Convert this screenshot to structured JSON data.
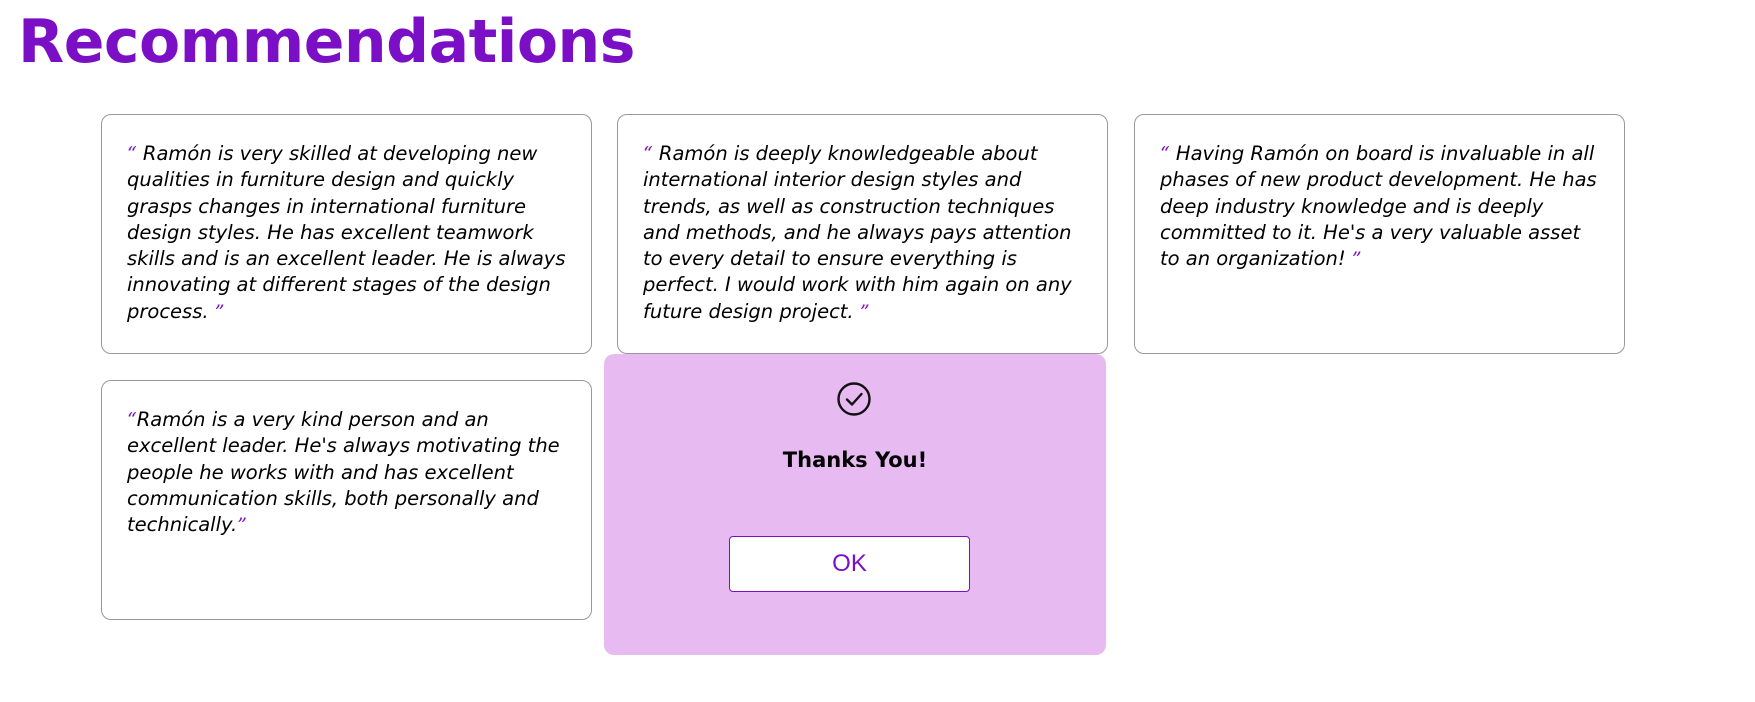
{
  "page": {
    "title": "Recommendations"
  },
  "colors": {
    "accent": "#7a0fc6",
    "modal_background": "#e7bbf2",
    "card_border": "#999999"
  },
  "recommendations": [
    {
      "open_quote": "“",
      "text": "Ramón is very skilled at developing new qualities in furniture design and quickly grasps changes in international furniture design styles. He has excellent teamwork skills and is an excellent leader. He is always innovating at different stages of the design process.",
      "close_quote": "”"
    },
    {
      "open_quote": "“",
      "text": "Ramón is deeply knowledgeable about international interior design styles and trends, as well as construction techniques and methods, and he always pays attention to every detail to ensure everything is perfect. I would work with him again on any future design project.",
      "close_quote": "”"
    },
    {
      "open_quote": "“",
      "text": "Having Ramón on board is invaluable in all phases of new product development. He has deep industry knowledge and is deeply committed to it. He's a very valuable asset to an organization!",
      "close_quote": "”"
    },
    {
      "open_quote": "“",
      "text": "Ramón is a very kind person and an excellent leader. He's always motivating the people he works with and has excellent communication skills, both personally and technically.",
      "close_quote": "”"
    }
  ],
  "dialog": {
    "icon": "check-circle-icon",
    "title": "Thanks You!",
    "ok_label": "OK"
  }
}
